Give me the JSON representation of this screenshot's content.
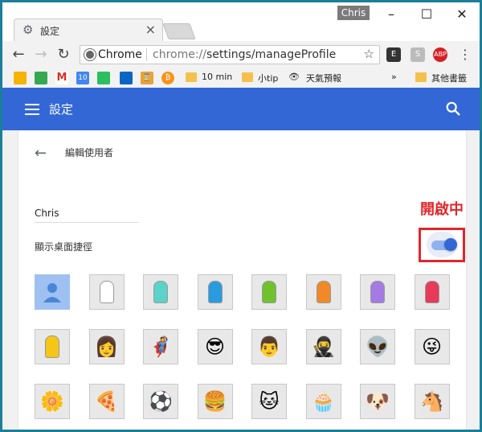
{
  "window": {
    "tab_title": "設定",
    "profile_name": "Chris"
  },
  "toolbar": {
    "omnibox_label": "Chrome",
    "url_prefix": "chrome://",
    "url_path": "settings/manageProfile"
  },
  "bookmarks": [
    {
      "icon": "google-drive-icon",
      "color": "#f4b400",
      "label": ""
    },
    {
      "icon": "google-maps-icon",
      "color": "#34a853",
      "label": ""
    },
    {
      "icon": "gmail-icon",
      "color": "#d93025",
      "label": ""
    },
    {
      "icon": "calendar-icon",
      "color": "#4285f4",
      "label": "10"
    },
    {
      "icon": "evernote-icon",
      "color": "#2dbe60",
      "label": ""
    },
    {
      "icon": "onedrive-icon",
      "color": "#0a66c2",
      "label": ""
    },
    {
      "icon": "hourglass-icon",
      "color": "#e8a33a",
      "label": ""
    },
    {
      "icon": "bitcoin-icon",
      "color": "#f7931a",
      "label": ""
    }
  ],
  "bookmark_folders": [
    {
      "label": "10 min"
    },
    {
      "label": "小tip"
    },
    {
      "label": "天氣預報"
    },
    {
      "label": "其他書籤"
    }
  ],
  "appbar": {
    "title": "設定"
  },
  "page": {
    "section_title": "編輯使用者",
    "name_value": "Chris",
    "shortcut_label": "顯示桌面捷徑",
    "shortcut_enabled": true,
    "annotation": "開啟中"
  },
  "avatars": [
    {
      "name": "generic-avatar",
      "type": "generic",
      "color": "#4a86d8"
    },
    {
      "name": "white-head-avatar",
      "type": "head",
      "color": "#ffffff"
    },
    {
      "name": "cyan-head-avatar",
      "type": "head",
      "color": "#5bd3c8"
    },
    {
      "name": "blue-head-avatar",
      "type": "head",
      "color": "#2b9be0"
    },
    {
      "name": "green-head-avatar",
      "type": "head",
      "color": "#6fc22d"
    },
    {
      "name": "orange-head-avatar",
      "type": "head",
      "color": "#f08a28"
    },
    {
      "name": "purple-head-avatar",
      "type": "head",
      "color": "#a57be3"
    },
    {
      "name": "red-head-avatar",
      "type": "head",
      "color": "#e63b5a"
    },
    {
      "name": "yellow-head-avatar",
      "type": "head",
      "color": "#f5c518"
    },
    {
      "name": "businesswoman-avatar",
      "type": "emoji",
      "glyph": "👩"
    },
    {
      "name": "superhero-avatar",
      "type": "emoji",
      "glyph": "🦸"
    },
    {
      "name": "woman-sunglasses-avatar",
      "type": "emoji",
      "glyph": "😎"
    },
    {
      "name": "man-avatar",
      "type": "emoji",
      "glyph": "👨"
    },
    {
      "name": "ninja-avatar",
      "type": "emoji",
      "glyph": "🥷"
    },
    {
      "name": "alien-avatar",
      "type": "emoji",
      "glyph": "👽"
    },
    {
      "name": "smiley-avatar",
      "type": "emoji",
      "glyph": "😜"
    },
    {
      "name": "flower-avatar",
      "type": "emoji",
      "glyph": "🌼"
    },
    {
      "name": "pizza-avatar",
      "type": "emoji",
      "glyph": "🍕"
    },
    {
      "name": "soccer-ball-avatar",
      "type": "emoji",
      "glyph": "⚽"
    },
    {
      "name": "hamburger-avatar",
      "type": "emoji",
      "glyph": "🍔"
    },
    {
      "name": "cat-avatar",
      "type": "emoji",
      "glyph": "🐱"
    },
    {
      "name": "cupcake-avatar",
      "type": "emoji",
      "glyph": "🧁"
    },
    {
      "name": "dog-avatar",
      "type": "emoji",
      "glyph": "🐶"
    },
    {
      "name": "horse-avatar",
      "type": "emoji",
      "glyph": "🐴"
    }
  ],
  "colors": {
    "accent": "#3367d6",
    "annotation": "#e0262a"
  }
}
